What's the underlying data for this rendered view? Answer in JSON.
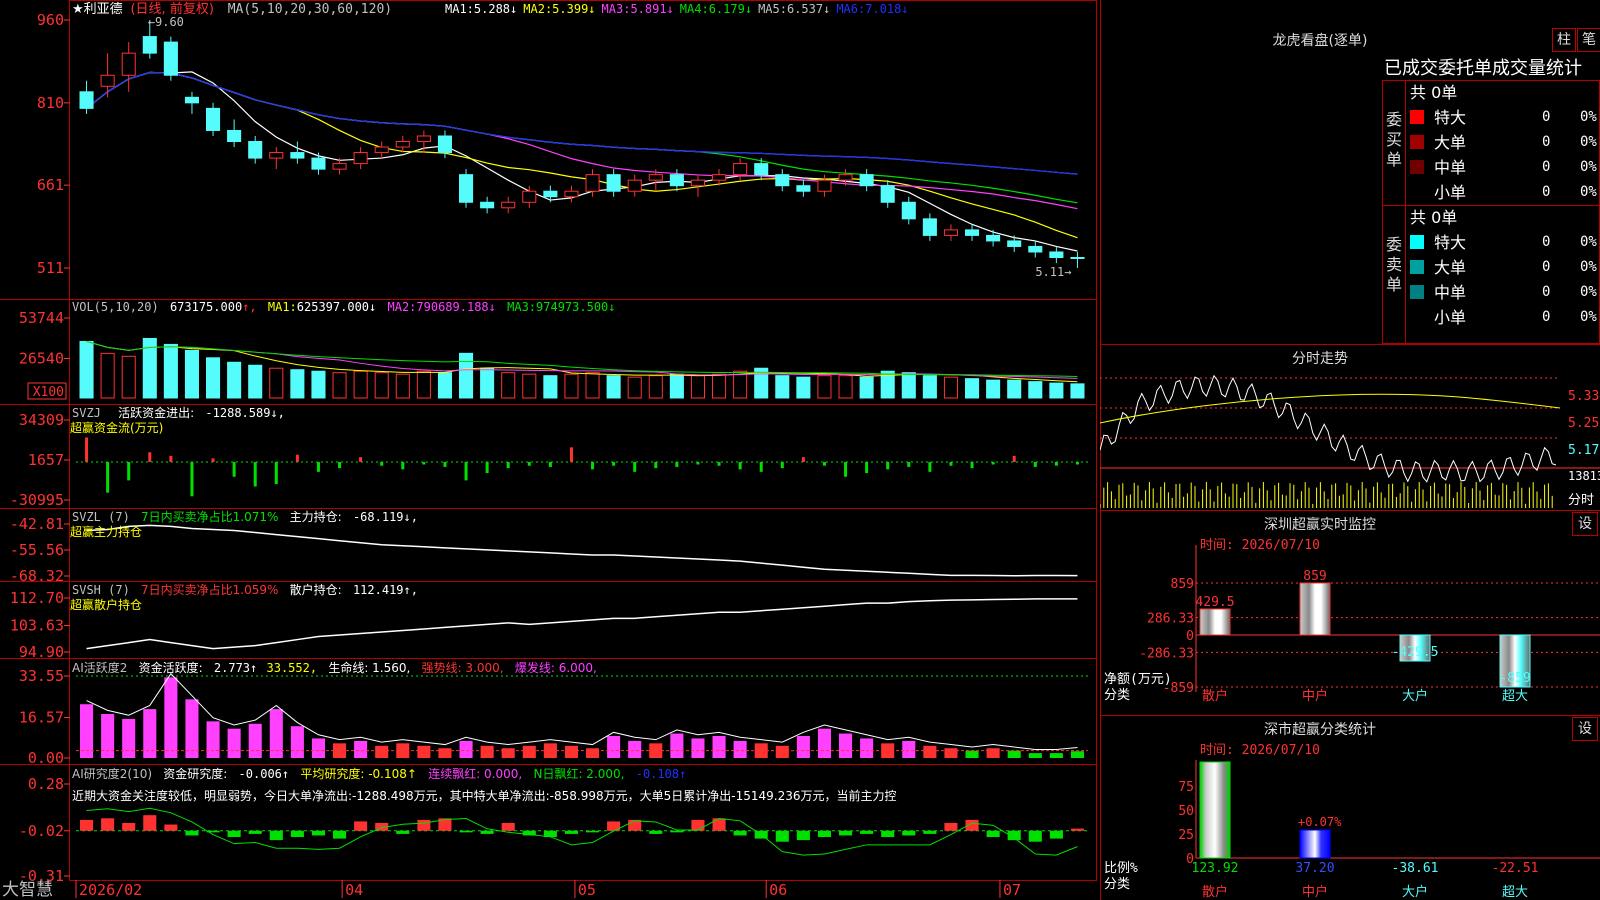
{
  "colors": {
    "up": "#ff3232",
    "down": "#54fcfc",
    "grid": "#b40000",
    "ma1": "#ffffff",
    "ma2": "#ffff00",
    "ma3": "#ff40ff",
    "ma4": "#00e000",
    "ma5": "#a0a0a0",
    "ma6": "#2030ff",
    "yellow": "#ffff00",
    "magenta": "#ff40ff",
    "green": "#00e000",
    "gray": "#c0c0c0",
    "red": "#ff3232",
    "cyan": "#54fcfc",
    "white": "#ffffff"
  },
  "main": {
    "stock_name": "★利亚德",
    "period": "(日线, 前复权)",
    "ma_label": "MA(5,10,20,30,60,120)",
    "ma_values": [
      {
        "k": "MA1:",
        "v": "5.288↓"
      },
      {
        "k": "MA2:",
        "v": "5.399↓"
      },
      {
        "k": "MA3:",
        "v": "5.891↓"
      },
      {
        "k": "MA4:",
        "v": "6.179↓"
      },
      {
        "k": "MA5:",
        "v": "6.537↓"
      },
      {
        "k": "MA6:",
        "v": "7.018↓"
      }
    ],
    "high_label": "9.60",
    "low_label": "5.11",
    "y_ticks": [
      "960",
      "810",
      "661",
      "511"
    ],
    "x_ticks": [
      "2026/02",
      "04",
      "05",
      "06",
      "07"
    ]
  },
  "vol": {
    "label": "VOL(5,10,20)",
    "value": "673175.000",
    "ma": [
      {
        "k": "MA1:",
        "v": "625397.000↓"
      },
      {
        "k": "MA2:",
        "v": "790689.188↓"
      },
      {
        "k": "MA3:",
        "v": "974973.500↓"
      }
    ],
    "y_ticks": [
      "53744",
      "26540"
    ],
    "unit": "X100"
  },
  "svzj": {
    "label": "SVZJ",
    "title": "活跃资金进出:",
    "value": "-1288.589↓,",
    "sub": "超赢资金流(万元)",
    "y_ticks": [
      "34309",
      "1657",
      "-30995"
    ]
  },
  "svzl": {
    "label": "SVZL (7)",
    "desc": "7日内买卖净占比1.071%",
    "title": "主力持仓:",
    "value": "-68.119↓,",
    "sub": "超赢主力持仓",
    "y_ticks": [
      "-42.81",
      "-55.56",
      "-68.32"
    ]
  },
  "svsh": {
    "label": "SVSH (7)",
    "desc": "7日内买卖净占比1.059%",
    "title": "散户持仓:",
    "value": "112.419↑,",
    "sub": "超赢散户持仓",
    "y_ticks": [
      "112.70",
      "103.63",
      "94.90"
    ]
  },
  "ai_active": {
    "label": "AI活跃度2",
    "title": "资金活跃度:",
    "value": "2.773↑",
    "v2": "33.552,",
    "life": "生命线: 1.560,",
    "strong": "强势线: 3.000,",
    "burst": "爆发线: 6.000,",
    "y_ticks": [
      "33.55",
      "16.57",
      "0.00"
    ]
  },
  "ai_research": {
    "label": "AI研究度2(10)",
    "title": "资金研究度:",
    "value": "-0.006↑",
    "avg": "平均研究度: -0.108↑",
    "cont": "连续飘红: 0.000,",
    "nday": "N日飘红: 2.000,",
    "last": "-0.108↑",
    "note": "近期大资金关注度较低，明显弱势，今日大单净流出:-1288.498万元，其中特大单净流出:-858.998万元，大单5日累计净出-15149.236万元，当前主力控",
    "y_ticks": [
      "0.28",
      "-0.02",
      "-0.31"
    ]
  },
  "app_name": "大智慧",
  "longhu": {
    "title": "龙虎看盘(逐单)",
    "btn1": "柱",
    "btn2": "笔",
    "header": "已成交委托单成交量统计",
    "buy": {
      "side": "委买单",
      "total": "共 0单",
      "rows": [
        {
          "name": "特大",
          "n": "0",
          "p": "0%",
          "c": "#ff0000"
        },
        {
          "name": "大单",
          "n": "0",
          "p": "0%",
          "c": "#a00000"
        },
        {
          "name": "中单",
          "n": "0",
          "p": "0%",
          "c": "#700000"
        },
        {
          "name": "小单",
          "n": "0",
          "p": "0%",
          "c": ""
        }
      ]
    },
    "sell": {
      "side": "委卖单",
      "total": "共 0单",
      "rows": [
        {
          "name": "特大",
          "n": "0",
          "p": "0%",
          "c": "#00ffff"
        },
        {
          "name": "大单",
          "n": "0",
          "p": "0%",
          "c": "#00a0a0"
        },
        {
          "name": "中单",
          "n": "0",
          "p": "0%",
          "c": "#008080"
        },
        {
          "name": "小单",
          "n": "0",
          "p": "0%",
          "c": ""
        }
      ]
    }
  },
  "intraday": {
    "title": "分时走势",
    "y_ticks": [
      "5.33",
      "5.25",
      "5.17"
    ],
    "vol_tick": "13813",
    "unit": "分时"
  },
  "monitor": {
    "title": "深圳超赢实时监控",
    "btn": "设",
    "time": "时间: 2026/07/10",
    "ylabel": "净额(万元)",
    "xlabel": "分类",
    "y_ticks": [
      "859",
      "286.33",
      "0",
      "-286.33",
      "-859"
    ]
  },
  "classify": {
    "title": "深市超赢分类统计",
    "btn": "设",
    "time": "时间: 2026/07/10",
    "ylabel": "比例%",
    "xlabel": "分类",
    "y_ticks": [
      "75",
      "50",
      "25",
      "0"
    ]
  },
  "chart_data": [
    {
      "type": "candlestick",
      "name": "K线",
      "ylim": [
        5.11,
        9.6
      ],
      "ohlc": [
        [
          8.3,
          8.5,
          7.9,
          8.0
        ],
        [
          8.4,
          9.0,
          8.2,
          8.6
        ],
        [
          8.6,
          9.2,
          8.3,
          9.0
        ],
        [
          9.3,
          9.6,
          8.9,
          9.0
        ],
        [
          9.2,
          9.3,
          8.5,
          8.6
        ],
        [
          8.2,
          8.3,
          7.9,
          8.1
        ],
        [
          8.0,
          8.1,
          7.5,
          7.6
        ],
        [
          7.6,
          7.8,
          7.3,
          7.4
        ],
        [
          7.4,
          7.5,
          7.0,
          7.1
        ],
        [
          7.1,
          7.3,
          6.9,
          7.2
        ],
        [
          7.2,
          7.4,
          7.0,
          7.1
        ],
        [
          7.1,
          7.2,
          6.8,
          6.9
        ],
        [
          6.9,
          7.1,
          6.8,
          7.0
        ],
        [
          7.0,
          7.3,
          6.9,
          7.2
        ],
        [
          7.2,
          7.4,
          7.1,
          7.3
        ],
        [
          7.3,
          7.5,
          7.2,
          7.4
        ],
        [
          7.4,
          7.6,
          7.2,
          7.5
        ],
        [
          7.5,
          7.6,
          7.1,
          7.2
        ],
        [
          6.8,
          6.9,
          6.2,
          6.3
        ],
        [
          6.3,
          6.4,
          6.1,
          6.2
        ],
        [
          6.2,
          6.4,
          6.1,
          6.3
        ],
        [
          6.3,
          6.6,
          6.2,
          6.5
        ],
        [
          6.5,
          6.6,
          6.3,
          6.4
        ],
        [
          6.4,
          6.6,
          6.3,
          6.5
        ],
        [
          6.5,
          6.9,
          6.4,
          6.8
        ],
        [
          6.8,
          6.9,
          6.4,
          6.5
        ],
        [
          6.5,
          6.8,
          6.4,
          6.7
        ],
        [
          6.7,
          6.9,
          6.5,
          6.8
        ],
        [
          6.8,
          6.9,
          6.5,
          6.6
        ],
        [
          6.6,
          6.8,
          6.4,
          6.7
        ],
        [
          6.7,
          6.9,
          6.6,
          6.8
        ],
        [
          6.8,
          7.1,
          6.7,
          7.0
        ],
        [
          7.0,
          7.1,
          6.7,
          6.8
        ],
        [
          6.8,
          6.9,
          6.5,
          6.6
        ],
        [
          6.6,
          6.7,
          6.4,
          6.5
        ],
        [
          6.5,
          6.8,
          6.4,
          6.7
        ],
        [
          6.7,
          6.9,
          6.6,
          6.8
        ],
        [
          6.8,
          6.9,
          6.5,
          6.6
        ],
        [
          6.6,
          6.7,
          6.2,
          6.3
        ],
        [
          6.3,
          6.4,
          5.9,
          6.0
        ],
        [
          6.0,
          6.1,
          5.6,
          5.7
        ],
        [
          5.7,
          5.9,
          5.6,
          5.8
        ],
        [
          5.8,
          5.9,
          5.6,
          5.7
        ],
        [
          5.7,
          5.8,
          5.5,
          5.6
        ],
        [
          5.6,
          5.7,
          5.4,
          5.5
        ],
        [
          5.5,
          5.6,
          5.3,
          5.4
        ],
        [
          5.4,
          5.5,
          5.2,
          5.3
        ],
        [
          5.3,
          5.4,
          5.11,
          5.29
        ]
      ]
    },
    {
      "type": "bar",
      "name": "VOL",
      "ylim": [
        0,
        53744
      ],
      "values": [
        38000,
        30000,
        28000,
        40000,
        36000,
        32000,
        27000,
        24000,
        22000,
        20000,
        19000,
        18000,
        17000,
        18000,
        17000,
        16000,
        18000,
        17000,
        30000,
        20000,
        17000,
        16000,
        15000,
        16000,
        17000,
        15000,
        14000,
        15000,
        16000,
        15000,
        16000,
        18000,
        20000,
        15000,
        14000,
        15000,
        15000,
        14000,
        18000,
        17000,
        15000,
        14000,
        13000,
        12000,
        12000,
        11000,
        10000,
        9500
      ]
    },
    {
      "type": "bar",
      "name": "SVZJ",
      "ylim": [
        -30995,
        34309
      ],
      "values": [
        20000,
        -25000,
        -15000,
        8000,
        5000,
        -28000,
        3000,
        -12000,
        -20000,
        -18000,
        6000,
        -8000,
        -5000,
        4000,
        -3000,
        -6000,
        -2000,
        -4000,
        -15000,
        -9000,
        -5000,
        -3000,
        -4000,
        12000,
        -6000,
        -3000,
        -8000,
        -5000,
        -4000,
        -2000,
        -3000,
        -6000,
        -8000,
        -5000,
        4000,
        -3000,
        -12000,
        -9000,
        -6000,
        -4000,
        -8000,
        -3000,
        -5000,
        -2000,
        5000,
        -4000,
        -3000,
        -2000
      ]
    },
    {
      "type": "line",
      "name": "主力持仓",
      "ylim": [
        -68.32,
        -42.81
      ],
      "values": [
        -46,
        -45.5,
        -44,
        -43.5,
        -44,
        -45,
        -45.5,
        -46,
        -47,
        -48,
        -49,
        -50,
        -51,
        -52,
        -53,
        -53.5,
        -54,
        -54.5,
        -55,
        -55.5,
        -56,
        -56.5,
        -57,
        -57.5,
        -58,
        -58,
        -58.5,
        -59,
        -59.5,
        -60,
        -60.5,
        -61,
        -62,
        -63,
        -64,
        -65,
        -65.5,
        -66,
        -66.5,
        -67,
        -67.5,
        -68,
        -68,
        -68.1,
        -68.2,
        -68.1,
        -68.1,
        -68.119
      ]
    },
    {
      "type": "line",
      "name": "散户持仓",
      "ylim": [
        94.9,
        112.7
      ],
      "values": [
        96,
        97,
        98,
        99,
        98,
        97,
        96,
        96.5,
        97,
        98,
        99,
        100,
        100.5,
        101,
        101.5,
        102,
        102.5,
        103,
        103.5,
        104,
        104.5,
        104,
        104.5,
        105,
        105.5,
        106,
        106,
        106.5,
        107,
        107.5,
        108,
        108,
        108.5,
        109,
        109.5,
        110,
        110.5,
        111,
        111,
        111.5,
        111.8,
        112,
        112.1,
        112.2,
        112.3,
        112.4,
        112.4,
        112.419
      ]
    },
    {
      "type": "bar",
      "name": "资金活跃度",
      "ylim": [
        0,
        33.55
      ],
      "values": [
        22,
        18,
        16,
        20,
        33,
        24,
        15,
        12,
        14,
        20,
        13,
        8,
        6,
        7,
        5,
        6,
        5,
        4,
        7,
        5,
        4,
        5,
        6,
        5,
        4,
        9,
        7,
        6,
        10,
        8,
        9,
        7,
        6,
        5,
        9,
        12,
        10,
        8,
        6,
        7,
        5,
        4,
        3,
        4,
        3,
        2,
        2,
        2.773
      ]
    },
    {
      "type": "bar",
      "name": "资金研究度",
      "ylim": [
        -0.31,
        0.28
      ],
      "values": [
        0.05,
        0.06,
        0.03,
        0.08,
        0.02,
        -0.05,
        -0.03,
        -0.06,
        -0.04,
        -0.08,
        -0.06,
        -0.05,
        -0.07,
        0.04,
        0.03,
        -0.04,
        0.05,
        0.06,
        -0.03,
        -0.04,
        0.03,
        -0.05,
        -0.06,
        -0.04,
        -0.03,
        0.04,
        0.05,
        -0.04,
        -0.03,
        0.05,
        0.06,
        -0.05,
        -0.07,
        -0.09,
        -0.08,
        -0.06,
        -0.05,
        -0.04,
        -0.06,
        -0.05,
        -0.04,
        0.03,
        0.05,
        -0.06,
        -0.08,
        -0.09,
        -0.07,
        -0.006
      ]
    },
    {
      "type": "bar",
      "name": "深圳超赢实时监控",
      "categories": [
        "散户",
        "中户",
        "大户",
        "超大"
      ],
      "values": [
        429.5,
        859,
        -429.5,
        -859
      ],
      "ylim": [
        -859,
        859
      ]
    },
    {
      "type": "bar",
      "name": "深市超赢分类统计",
      "categories": [
        "散户",
        "中户",
        "大户",
        "超大"
      ],
      "values": [
        123.92,
        37.2,
        -38.61,
        -22.51
      ],
      "bar_labels": [
        "123.92",
        "37.20",
        "-38.61",
        "-22.51"
      ],
      "mid_label": "+0.07%"
    }
  ]
}
